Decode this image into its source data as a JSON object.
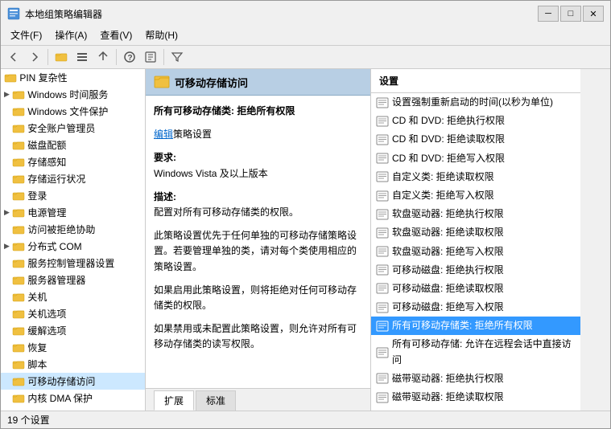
{
  "window": {
    "title": "本地组策略编辑器",
    "controls": {
      "minimize": "─",
      "maximize": "□",
      "close": "✕"
    }
  },
  "menubar": {
    "items": [
      {
        "label": "文件(F)"
      },
      {
        "label": "操作(A)"
      },
      {
        "label": "查看(V)"
      },
      {
        "label": "帮助(H)"
      }
    ]
  },
  "toolbar": {
    "back_tooltip": "后退",
    "forward_tooltip": "前进"
  },
  "sidebar": {
    "items": [
      {
        "label": "PIN 复杂性",
        "indent": 0,
        "has_arrow": false
      },
      {
        "label": "Windows 时间服务",
        "indent": 0,
        "has_arrow": true
      },
      {
        "label": "Windows 文件保护",
        "indent": 0,
        "has_arrow": false
      },
      {
        "label": "安全账户管理员",
        "indent": 0,
        "has_arrow": false
      },
      {
        "label": "磁盘配额",
        "indent": 0,
        "has_arrow": false
      },
      {
        "label": "存储感知",
        "indent": 0,
        "has_arrow": false
      },
      {
        "label": "存储运行状况",
        "indent": 0,
        "has_arrow": false
      },
      {
        "label": "登录",
        "indent": 0,
        "has_arrow": false
      },
      {
        "label": "电源管理",
        "indent": 0,
        "has_arrow": true
      },
      {
        "label": "访问被拒绝协助",
        "indent": 0,
        "has_arrow": false
      },
      {
        "label": "分布式 COM",
        "indent": 0,
        "has_arrow": true
      },
      {
        "label": "服务控制管理器设置",
        "indent": 0,
        "has_arrow": false
      },
      {
        "label": "服务器管理器",
        "indent": 0,
        "has_arrow": false
      },
      {
        "label": "关机",
        "indent": 0,
        "has_arrow": false
      },
      {
        "label": "关机选项",
        "indent": 0,
        "has_arrow": false
      },
      {
        "label": "缓解选项",
        "indent": 0,
        "has_arrow": false
      },
      {
        "label": "恢复",
        "indent": 0,
        "has_arrow": false
      },
      {
        "label": "脚本",
        "indent": 0,
        "has_arrow": false
      },
      {
        "label": "可移动存储访问",
        "indent": 0,
        "has_arrow": false,
        "active": true
      },
      {
        "label": "内核 DMA 保护",
        "indent": 0,
        "has_arrow": false
      }
    ]
  },
  "policy_detail": {
    "header_title": "可移动存储访问",
    "main_title": "所有可移动存储类: 拒绝所有权限",
    "edit_link_label": "编辑",
    "edit_link_suffix": "策略设置",
    "requirement_label": "要求:",
    "requirement_value": "Windows Vista 及以上版本",
    "description_label": "描述:",
    "description_text": "配置对所有可移动存储类的权限。",
    "para1": "此策略设置优先于任何单独的可移动存储策略设置。若要管理单独的类，请对每个类使用相应的策略设置。",
    "para2": "如果启用此策略设置，则将拒绝对任何可移动存储类的权限。",
    "para3": "如果禁用或未配置此策略设置，则允许对所有可移动存储类的读写权限。"
  },
  "policy_list": {
    "header": "设置",
    "items": [
      {
        "label": "设置强制重新启动的时间(以秒为单位)"
      },
      {
        "label": "CD 和 DVD: 拒绝执行权限"
      },
      {
        "label": "CD 和 DVD: 拒绝读取权限"
      },
      {
        "label": "CD 和 DVD: 拒绝写入权限"
      },
      {
        "label": "自定义类: 拒绝读取权限"
      },
      {
        "label": "自定义类: 拒绝写入权限"
      },
      {
        "label": "软盘驱动器: 拒绝执行权限"
      },
      {
        "label": "软盘驱动器: 拒绝读取权限"
      },
      {
        "label": "软盘驱动器: 拒绝写入权限"
      },
      {
        "label": "可移动磁盘: 拒绝执行权限"
      },
      {
        "label": "可移动磁盘: 拒绝读取权限"
      },
      {
        "label": "可移动磁盘: 拒绝写入权限"
      },
      {
        "label": "所有可移动存储类: 拒绝所有权限",
        "selected": true
      },
      {
        "label": "所有可移动存储: 允许在远程会话中直接访问"
      },
      {
        "label": "磁带驱动器: 拒绝执行权限"
      },
      {
        "label": "磁带驱动器: 拒绝读取权限"
      }
    ]
  },
  "tabs": [
    {
      "label": "扩展",
      "active": true
    },
    {
      "label": "标准",
      "active": false
    }
  ],
  "status_bar": {
    "text": "19 个设置"
  },
  "colors": {
    "header_bg": "#b8cfe4",
    "selected_bg": "#3174c7",
    "link_color": "#0066cc"
  }
}
